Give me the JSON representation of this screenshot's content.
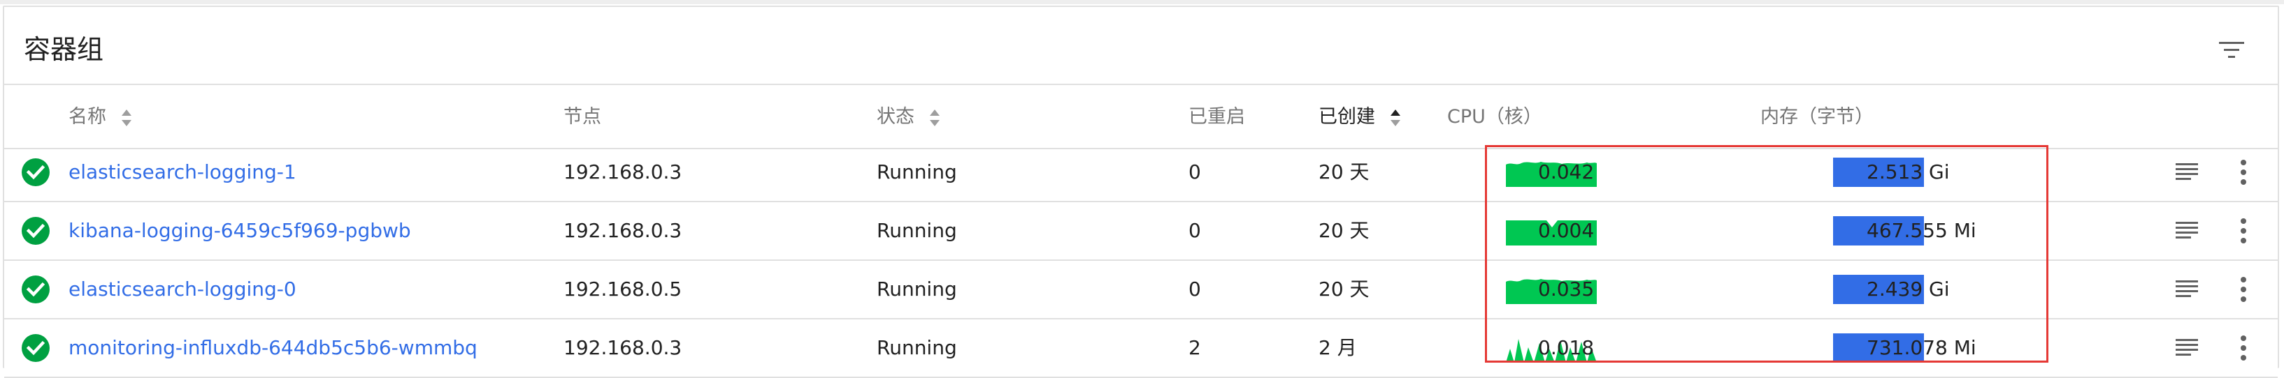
{
  "card": {
    "title": "容器组"
  },
  "icons": {
    "filter": "filter-list-icon",
    "status": "check-circle-icon",
    "logs": "logs-icon",
    "more": "more-vert-icon"
  },
  "colors": {
    "success": "#00a041",
    "link": "#326de6",
    "cpu": "#00c752",
    "memory": "#326de6",
    "highlight": "#e53935"
  },
  "columns": {
    "name": "名称",
    "node": "节点",
    "status": "状态",
    "restarts": "已重启",
    "created": "已创建",
    "cpu": "CPU（核）",
    "memory": "内存（字节）"
  },
  "rows": [
    {
      "name": "elasticsearch-logging-1",
      "node": "192.168.0.3",
      "status": "Running",
      "restarts": "0",
      "created": "20 天",
      "cpu": "0.042",
      "memory": "2.513 Gi",
      "cpu_pattern": "flat-wavy"
    },
    {
      "name": "kibana-logging-6459c5f969-pgbwb",
      "node": "192.168.0.3",
      "status": "Running",
      "restarts": "0",
      "created": "20 天",
      "cpu": "0.004",
      "memory": "467.555 Mi",
      "cpu_pattern": "flat-dip"
    },
    {
      "name": "elasticsearch-logging-0",
      "node": "192.168.0.5",
      "status": "Running",
      "restarts": "0",
      "created": "20 天",
      "cpu": "0.035",
      "memory": "2.439 Gi",
      "cpu_pattern": "flat-wavy"
    },
    {
      "name": "monitoring-influxdb-644db5c5b6-wmmbq",
      "node": "192.168.0.3",
      "status": "Running",
      "restarts": "2",
      "created": "2 月",
      "cpu": "0.018",
      "memory": "731.078 Mi",
      "cpu_pattern": "spiky"
    }
  ]
}
